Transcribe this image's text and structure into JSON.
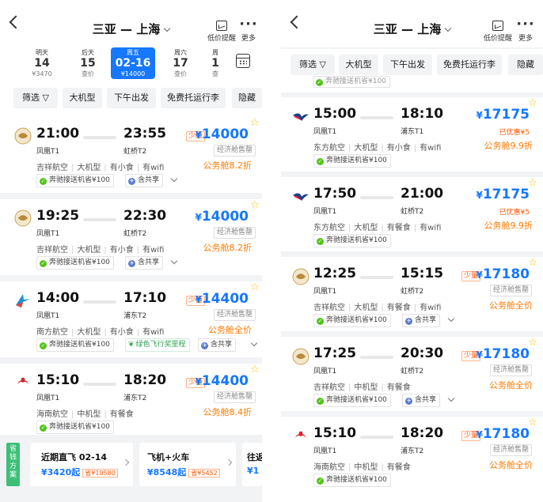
{
  "header": {
    "route": "三亚 — 上海",
    "price_alert_label": "低价提醒",
    "more_label": "更多"
  },
  "dates": [
    {
      "weekday": "明天",
      "day": "14",
      "price": "¥3470",
      "selected": false
    },
    {
      "weekday": "后天",
      "day": "15",
      "price": "查价",
      "selected": false
    },
    {
      "weekday": "周五",
      "day": "02-16",
      "price": "¥14000",
      "selected": true
    },
    {
      "weekday": "周六",
      "day": "17",
      "price": "查价",
      "selected": false
    },
    {
      "weekday": "周",
      "day": "1",
      "price": "查",
      "selected": false
    }
  ],
  "filters": [
    "筛选 ▽",
    "大机型",
    "下午出发",
    "免费托运行李",
    "隐藏"
  ],
  "left_flights": [
    {
      "airline_logo": "juneyao-logo",
      "dep_time": "21:00",
      "arr_time": "23:55",
      "dep_airport": "凤凰T1",
      "arr_airport": "虹桥T2",
      "low_stock": "少量",
      "currency": "¥",
      "price": "14000",
      "cabin": "经济舱售罄",
      "discount": "公务舱8.2折",
      "meta": [
        "吉祥航空",
        "大机型",
        "有小食",
        "有wifi"
      ],
      "tags": [
        "奔驰接送机省¥100",
        "含共享"
      ]
    },
    {
      "airline_logo": "juneyao-logo",
      "dep_time": "19:25",
      "arr_time": "22:30",
      "dep_airport": "凤凰T1",
      "arr_airport": "虹桥T2",
      "low_stock": "",
      "currency": "¥",
      "price": "14000",
      "cabin": "经济舱售罄",
      "discount": "公务舱8.2折",
      "meta": [
        "吉祥航空",
        "大机型",
        "有小食",
        "有wifi"
      ],
      "tags": [
        "奔驰接送机省¥100",
        "含共享"
      ]
    },
    {
      "airline_logo": "china-southern-logo",
      "dep_time": "14:00",
      "arr_time": "17:10",
      "dep_airport": "凤凰T1",
      "arr_airport": "浦东T2",
      "low_stock": "少量",
      "currency": "¥",
      "price": "14400",
      "cabin": "经济舱售罄",
      "discount": "公务舱全价",
      "meta": [
        "南方航空",
        "大机型",
        "有小食",
        "有wifi"
      ],
      "tags": [
        "奔驰接送机省¥100",
        "绿色飞行奖里程",
        "含共享"
      ]
    },
    {
      "airline_logo": "hainan-airlines-logo",
      "dep_time": "15:10",
      "arr_time": "18:20",
      "dep_airport": "凤凰T1",
      "arr_airport": "浦东T2",
      "low_stock": "少量",
      "currency": "¥",
      "price": "14400",
      "cabin": "经济舱售罄",
      "discount": "公务舱8.4折",
      "meta": [
        "海南航空",
        "中机型",
        "有餐食"
      ],
      "tags": [
        "奔驰接送机省¥100"
      ]
    }
  ],
  "bottom": {
    "side_label": "省钱方案",
    "cards": [
      {
        "title": "近期直飞 02-14",
        "price": "¥3420起",
        "save": "省¥10580"
      },
      {
        "title": "飞机+火车",
        "price": "¥8548起",
        "save": "省¥5452"
      },
      {
        "title": "往返",
        "price": "¥1",
        "save": ""
      }
    ]
  },
  "right_top_tag": "奔驰接送机省¥100",
  "right_flights": [
    {
      "airline_logo": "china-eastern-logo",
      "dep_time": "15:00",
      "arr_time": "18:10",
      "dep_airport": "凤凰T1",
      "arr_airport": "浦东T1",
      "low_stock": "",
      "currency": "¥",
      "price": "17175",
      "saved": "已优惠¥5",
      "cabin": "",
      "discount": "公务舱9.9折",
      "meta": [
        "东方航空",
        "大机型",
        "有小食",
        "有wifi"
      ],
      "tags": [
        "奔驰接送机省¥100"
      ]
    },
    {
      "airline_logo": "china-eastern-logo",
      "dep_time": "17:50",
      "arr_time": "21:00",
      "dep_airport": "凤凰T1",
      "arr_airport": "虹桥T2",
      "low_stock": "",
      "currency": "¥",
      "price": "17175",
      "saved": "已优惠¥5",
      "cabin": "",
      "discount": "公务舱9.9折",
      "meta": [
        "东方航空",
        "大机型",
        "有餐食",
        "有wifi"
      ],
      "tags": [
        "奔驰接送机省¥100"
      ]
    },
    {
      "airline_logo": "juneyao-logo",
      "dep_time": "12:25",
      "arr_time": "15:15",
      "dep_airport": "凤凰T1",
      "arr_airport": "虹桥T2",
      "low_stock": "少量",
      "currency": "¥",
      "price": "17180",
      "saved": "",
      "cabin": "经济舱售罄",
      "discount": "公务舱全价",
      "meta": [
        "吉祥航空",
        "大机型",
        "有餐食",
        "有wifi"
      ],
      "tags": [
        "奔驰接送机省¥100",
        "含共享"
      ]
    },
    {
      "airline_logo": "juneyao-logo",
      "dep_time": "17:25",
      "arr_time": "20:30",
      "dep_airport": "凤凰T1",
      "arr_airport": "虹桥T2",
      "low_stock": "少量",
      "currency": "¥",
      "price": "17180",
      "saved": "",
      "cabin": "经济舱售罄",
      "discount": "公务舱全价",
      "meta": [
        "吉祥航空",
        "中机型",
        "有餐食"
      ],
      "tags": [
        "奔驰接送机省¥100",
        "含共享"
      ]
    },
    {
      "airline_logo": "hainan-airlines-logo",
      "dep_time": "15:10",
      "arr_time": "18:20",
      "dep_airport": "凤凰T1",
      "arr_airport": "浦东T2",
      "low_stock": "少量",
      "currency": "¥",
      "price": "17180",
      "saved": "",
      "cabin": "经济舱售罄",
      "discount": "公务舱全价",
      "meta": [
        "海南航空",
        "中机型",
        "有餐食"
      ],
      "tags": [
        "奔驰接送机省¥100"
      ]
    }
  ],
  "colors": {
    "accent": "#1677ff",
    "discount": "#ff7a00",
    "low_stock": "#ff5500",
    "check": "#52c41a",
    "green": "#3dbf79"
  }
}
